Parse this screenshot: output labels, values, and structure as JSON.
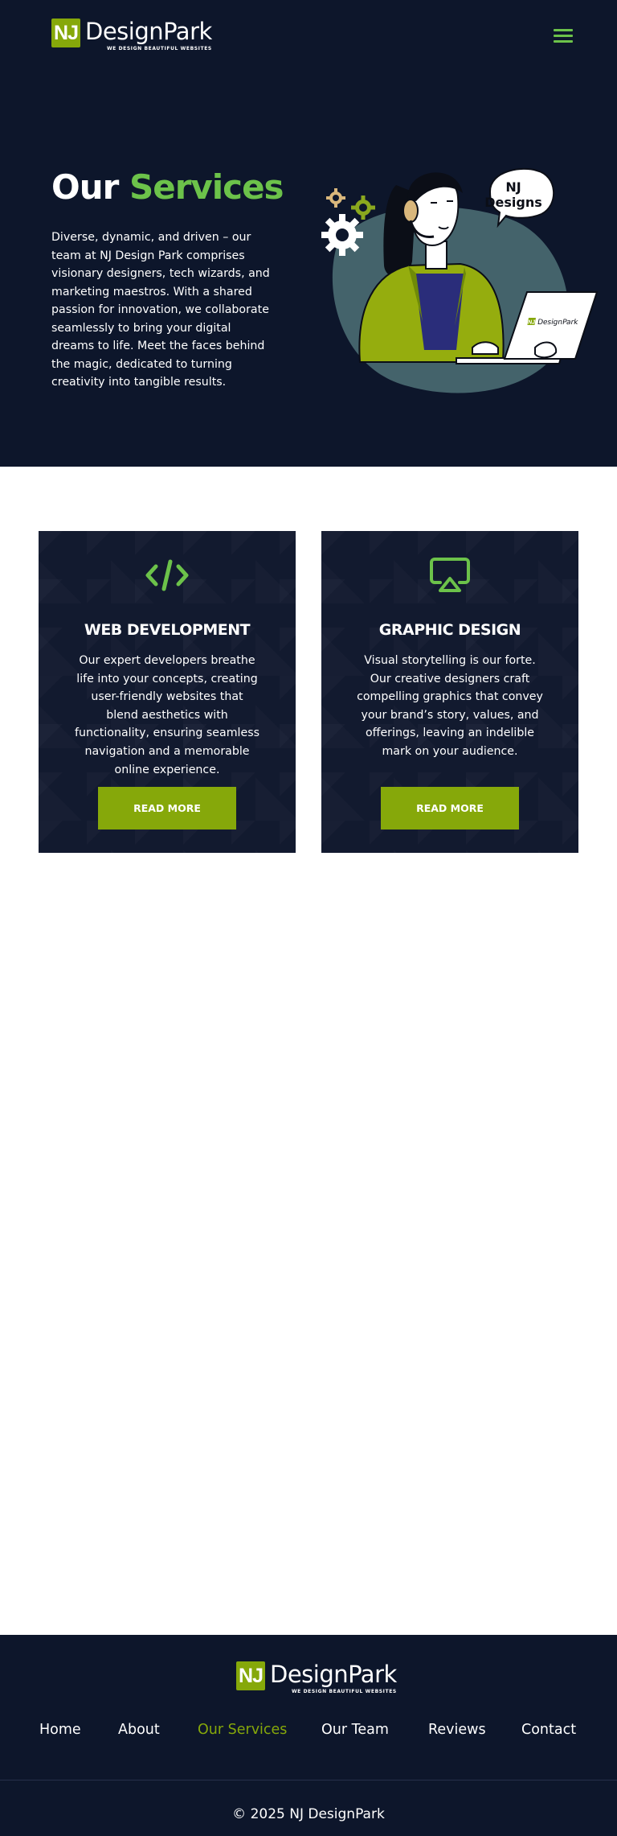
{
  "header": {
    "logo_badge": "NJ",
    "logo_name": "DesignPark",
    "logo_tagline": "WE DESIGN BEAUTIFUL WEBSITES",
    "menu_icon": "hamburger-icon"
  },
  "hero": {
    "title_part1": "Our",
    "title_part2": "Services",
    "description": "Diverse, dynamic, and driven – our team at NJ Design Park comprises visionary designers, tech wizards, and marketing maestros. With a shared passion for innovation, we collaborate seamlessly to bring your digital dreams to life. Meet the faces behind the magic, dedicated to turning creativity into tangible results.",
    "speech_bubble_line1": "NJ",
    "speech_bubble_line2": "Designs",
    "laptop_logo_badge": "NJ",
    "laptop_logo_name": "DesignPark"
  },
  "services": [
    {
      "icon": "code-icon",
      "title": "WEB DEVELOPMENT",
      "text": "Our expert developers breathe life into your concepts, creating user-friendly websites that blend aesthetics with functionality, ensuring seamless navigation and a memorable online experience.",
      "button": "READ MORE"
    },
    {
      "icon": "airplay-icon",
      "title": "GRAPHIC DESIGN",
      "text": "Visual storytelling is our forte. Our creative designers craft compelling graphics that convey your brand’s story, values, and offerings, leaving an indelible mark on your audience.",
      "button": "READ MORE"
    }
  ],
  "footer": {
    "logo_badge": "NJ",
    "logo_name": "DesignPark",
    "logo_tagline": "WE DESIGN BEAUTIFUL WEBSITES",
    "nav": [
      "Home",
      "About",
      "Our Services",
      "Our Team",
      "Reviews",
      "Contact"
    ],
    "active_nav": "Our Services",
    "copyright": "© 2025 NJ DesignPark"
  },
  "colors": {
    "navy": "#0d162b",
    "accent_green": "#6cc24a",
    "olive": "#86a80a"
  }
}
